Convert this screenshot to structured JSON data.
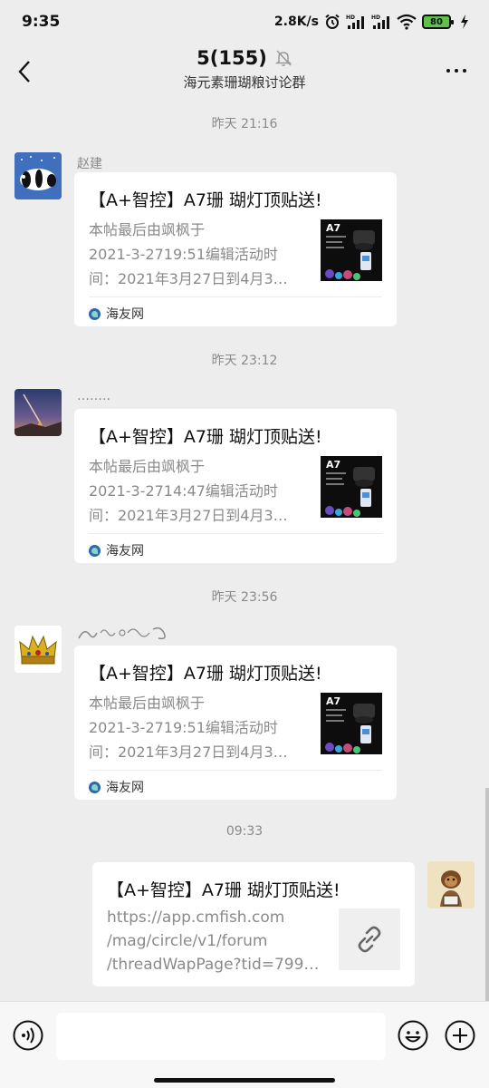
{
  "status_bar": {
    "time": "9:35",
    "net_speed": "2.8K/s",
    "battery": "80",
    "icons": [
      "alarm-icon",
      "signal-hd-icon",
      "signal-hd-icon",
      "wifi-icon",
      "battery-icon",
      "charging-icon"
    ]
  },
  "header": {
    "title": "5(155)",
    "subtitle": "海元素珊瑚粮讨论群",
    "icons": [
      "back-icon",
      "mute-bell-icon",
      "more-icon"
    ]
  },
  "messages": [
    {
      "timestamp": "昨天 21:16",
      "sender": "赵建",
      "card": {
        "title": "【A+智控】A7珊 瑚灯顶贴送!",
        "desc": [
          "本帖最后由飒枫于",
          "2021-3-2719:51编辑活动时",
          "间：2021年3月27日到4月3…"
        ],
        "thumb_label": "A7",
        "source": "海友网"
      }
    },
    {
      "timestamp": "昨天 23:12",
      "sender": "……..",
      "card": {
        "title": "【A+智控】A7珊 瑚灯顶贴送!",
        "desc": [
          "本帖最后由飒枫于",
          "2021-3-2714:47编辑活动时",
          "间：2021年3月27日到4月3…"
        ],
        "thumb_label": "A7",
        "source": "海友网"
      }
    },
    {
      "timestamp": "昨天 23:56",
      "sender": "",
      "card": {
        "title": "【A+智控】A7珊 瑚灯顶贴送!",
        "desc": [
          "本帖最后由飒枫于",
          "2021-3-2719:51编辑活动时",
          "间：2021年3月27日到4月3…"
        ],
        "thumb_label": "A7",
        "source": "海友网"
      }
    },
    {
      "timestamp": "09:33",
      "sender": "",
      "link": {
        "title": "【A+智控】A7珊 瑚灯顶贴送!",
        "url": [
          "https://app.cmfish.com",
          "/mag/circle/v1/forum",
          "/threadWapPage?tid=799…"
        ]
      }
    }
  ],
  "input_bar": {
    "placeholder": "",
    "icons": [
      "voice-icon",
      "emoji-icon",
      "plus-icon"
    ]
  },
  "colors": {
    "background": "#ededed",
    "card": "#ffffff",
    "muted_text": "#8a8a8a",
    "battery_fill": "#5ec24a"
  }
}
